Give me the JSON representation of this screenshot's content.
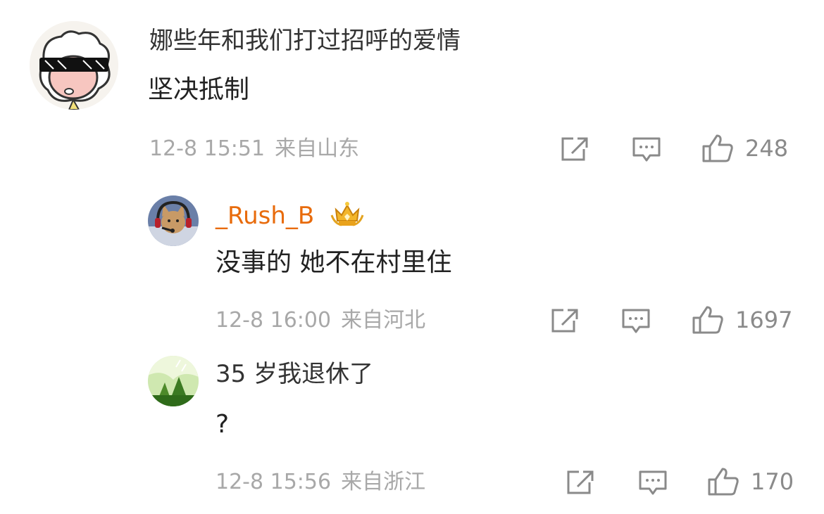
{
  "comments": [
    {
      "username": "娜些年和我们打过招呼的爱情",
      "content": "坚决抵制",
      "time": "12-8 15:51",
      "location": "来自山东",
      "likes": "248",
      "avatar_icon": "cartoon-sheep-sunglasses-avatar"
    },
    {
      "username": "_Rush_B",
      "vip_badge_icon": "gold-crown-badge-icon",
      "content": "没事的  她不在村里住",
      "time": "12-8 16:00",
      "location": "来自河北",
      "likes": "1697",
      "avatar_icon": "cat-with-headset-avatar"
    },
    {
      "username": "35 岁我退休了",
      "content": "?",
      "time": "12-8 15:56",
      "location": "来自浙江",
      "likes": "170",
      "avatar_icon": "green-forest-avatar"
    }
  ],
  "colors": {
    "text_primary": "#222222",
    "meta_gray": "#a8a8a8",
    "icon_gray": "#8a8a8a",
    "vip_orange": "#e86b0c"
  }
}
